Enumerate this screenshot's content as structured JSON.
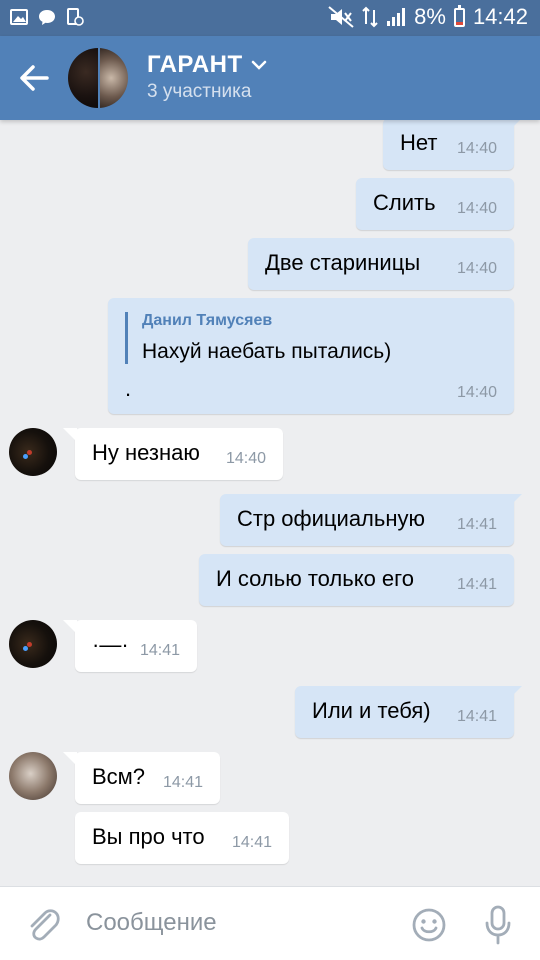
{
  "status_bar": {
    "battery": "8%",
    "time": "14:42"
  },
  "header": {
    "title": "ГАРАНТ",
    "subtitle": "3 участника"
  },
  "messages": [
    {
      "text": "Нет",
      "time": "14:40",
      "dir": "out"
    },
    {
      "text": "Слить",
      "time": "14:40",
      "dir": "out"
    },
    {
      "text": "Две стариницы",
      "time": "14:40",
      "dir": "out"
    },
    {
      "reply_name": "Данил Тямусяев",
      "reply_text": "Нахуй наебать пытались)",
      "text": ".",
      "time": "14:40",
      "dir": "out"
    },
    {
      "text": "Ну незнаю",
      "time": "14:40",
      "dir": "in"
    },
    {
      "text": "Стр официальную",
      "time": "14:41",
      "dir": "out"
    },
    {
      "text": "И солью только его",
      "time": "14:41",
      "dir": "out"
    },
    {
      "text": "·—·",
      "time": "14:41",
      "dir": "in"
    },
    {
      "text": "Или и тебя)",
      "time": "14:41",
      "dir": "out"
    },
    {
      "text": "Всм?",
      "time": "14:41",
      "dir": "in"
    },
    {
      "text": "Вы про что",
      "time": "14:41",
      "dir": "in"
    }
  ],
  "composer": {
    "placeholder": "Сообщение"
  },
  "colors": {
    "header": "#5181b8",
    "status_bar": "#4a6f9c",
    "outgoing_bubble": "#d6e5f6",
    "incoming_bubble": "#ffffff",
    "background": "#edeef0"
  }
}
